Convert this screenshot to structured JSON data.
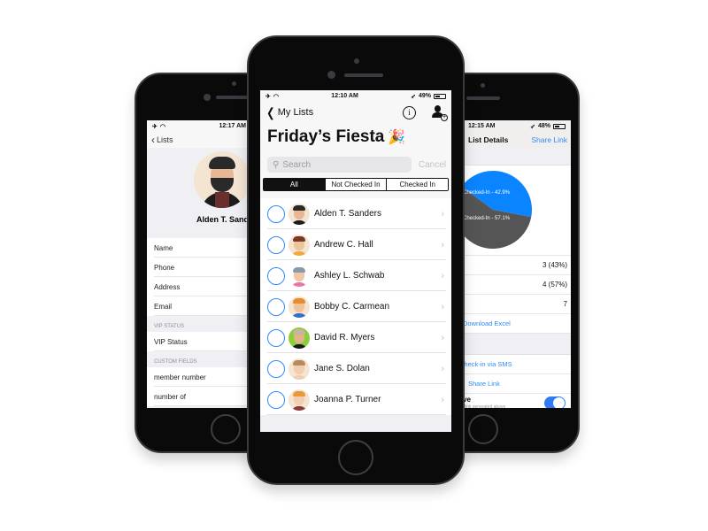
{
  "phones": {
    "left": {
      "status_time": "12:17 AM",
      "back_label": "Lists",
      "contact_name": "Alden T. Sanders",
      "fields": [
        "Name",
        "Phone",
        "Address",
        "Email"
      ],
      "vip_section": "VIP STATUS",
      "vip_field": "VIP Status",
      "custom_section": "CUSTOM FIELDS",
      "custom_fields": [
        "member number",
        "number of"
      ]
    },
    "center": {
      "status_time": "12:10 AM",
      "battery": "49%",
      "back_label": "My Lists",
      "title": "Friday’s Fiesta",
      "title_emoji": "🎉",
      "search_placeholder": "Search",
      "cancel_label": "Cancel",
      "segments": [
        {
          "label": "All",
          "active": true
        },
        {
          "label": "Not Checked In",
          "active": false
        },
        {
          "label": "Checked In",
          "active": false
        }
      ],
      "guests": [
        {
          "name": "Alden T. Sanders",
          "skin": "#e8b894",
          "hair": "#2a2a2a",
          "shirt": "#1c1c1c",
          "bg": "#f4e5d3"
        },
        {
          "name": "Andrew C. Hall",
          "skin": "#f0c49a",
          "hair": "#7a3a22",
          "shirt": "#f2a93b",
          "bg": "#f4e5d3"
        },
        {
          "name": "Ashley L. Schwab",
          "skin": "#f0c8a8",
          "hair": "#8a9aa8",
          "shirt": "#e879a6",
          "bg": "#ffffff"
        },
        {
          "name": "Bobby C. Carmean",
          "skin": "#f2c39a",
          "hair": "#e88a2e",
          "shirt": "#2f6fd0",
          "bg": "#f4e5d3"
        },
        {
          "name": "David R. Myers",
          "skin": "#e2b48a",
          "hair": "#c8b49a",
          "shirt": "#1a1a1a",
          "bg": "#8ccd3a"
        },
        {
          "name": "Jane S. Dolan",
          "skin": "#f3cdb0",
          "hair": "#b88a5c",
          "shirt": "#f3cdb0",
          "bg": "#f4e5d3"
        },
        {
          "name": "Joanna P. Turner",
          "skin": "#f3cdb0",
          "hair": "#e89a3a",
          "shirt": "#8a3a3a",
          "bg": "#f4e5d3"
        }
      ]
    },
    "right": {
      "status_time": "12:15 AM",
      "battery": "48%",
      "nav_title": "List Details",
      "nav_link": "Share Link",
      "chart_data": {
        "type": "pie",
        "slices": [
          {
            "label": "Checked-In - 42.9%",
            "value": 42.9,
            "color": "#0a84ff"
          },
          {
            "label": "Checked-In - 57.1%",
            "value": 57.1,
            "color": "#555555"
          }
        ]
      },
      "stats": [
        "3 (43%)",
        "4 (57%)",
        "7"
      ],
      "download_label": "Download Excel",
      "sms_label": "Check-in via SMS",
      "share_label": "Share Link",
      "toggle_title": "ve",
      "toggle_subtitle": "re link generated above",
      "toggle_on": true
    }
  }
}
